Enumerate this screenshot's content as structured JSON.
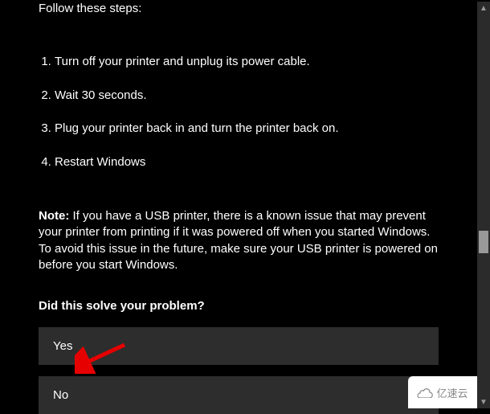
{
  "intro": "Follow these steps:",
  "steps": [
    "Turn off your printer and unplug its power cable.",
    "Wait 30 seconds.",
    "Plug your printer back in and turn the printer back on.",
    "Restart Windows"
  ],
  "note": {
    "label": "Note:",
    "text": " If you have a USB printer, there is a known issue that may prevent your printer from printing if it was powered off when you started Windows. To avoid this issue in the future, make sure your USB printer is powered on before you start Windows."
  },
  "question": "Did this solve your problem?",
  "options": {
    "yes": "Yes",
    "no": "No"
  },
  "watermark": "亿速云"
}
